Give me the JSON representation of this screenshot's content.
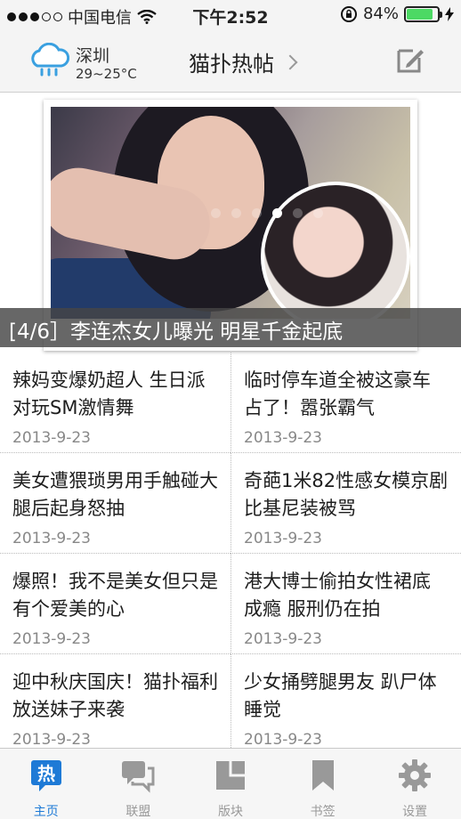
{
  "status_bar": {
    "carrier": "中国电信",
    "time": "下午2:52",
    "battery": "84%",
    "battery_level": 0.84
  },
  "header": {
    "city": "深圳",
    "temperature": "29~25°C",
    "title": "猫扑热帖"
  },
  "banner": {
    "caption": "[4/6］李连杰女儿曝光 明星千金起底",
    "page_count": 6,
    "active_page": 4
  },
  "articles": [
    {
      "title": "辣妈变爆奶超人 生日派对玩SM激情舞",
      "date": "2013-9-23"
    },
    {
      "title": "临时停车道全被这豪车占了！嚣张霸气",
      "date": "2013-9-23"
    },
    {
      "title": "美女遭猥琐男用手触碰大腿后起身怒抽",
      "date": "2013-9-23"
    },
    {
      "title": "奇葩1米82性感女模京剧比基尼装被骂",
      "date": "2013-9-23"
    },
    {
      "title": "爆照！我不是美女但只是有个爱美的心",
      "date": "2013-9-23"
    },
    {
      "title": "港大博士偷拍女性裙底成瘾 服刑仍在拍",
      "date": "2013-9-23"
    },
    {
      "title": "迎中秋庆国庆！猫扑福利放送妹子来袭",
      "date": "2013-9-23"
    },
    {
      "title": "少女捅劈腿男友 趴尸体睡觉",
      "date": "2013-9-23"
    }
  ],
  "tabs": [
    {
      "label": "主页",
      "icon": "hot-icon",
      "active": true
    },
    {
      "label": "联盟",
      "icon": "chat-bubbles-icon",
      "active": false
    },
    {
      "label": "版块",
      "icon": "blocks-icon",
      "active": false
    },
    {
      "label": "书签",
      "icon": "bookmark-icon",
      "active": false
    },
    {
      "label": "设置",
      "icon": "gear-icon",
      "active": false
    }
  ],
  "colors": {
    "accent": "#1e7ad6",
    "tab_inactive": "#999999",
    "battery_fill": "#4cd964"
  }
}
